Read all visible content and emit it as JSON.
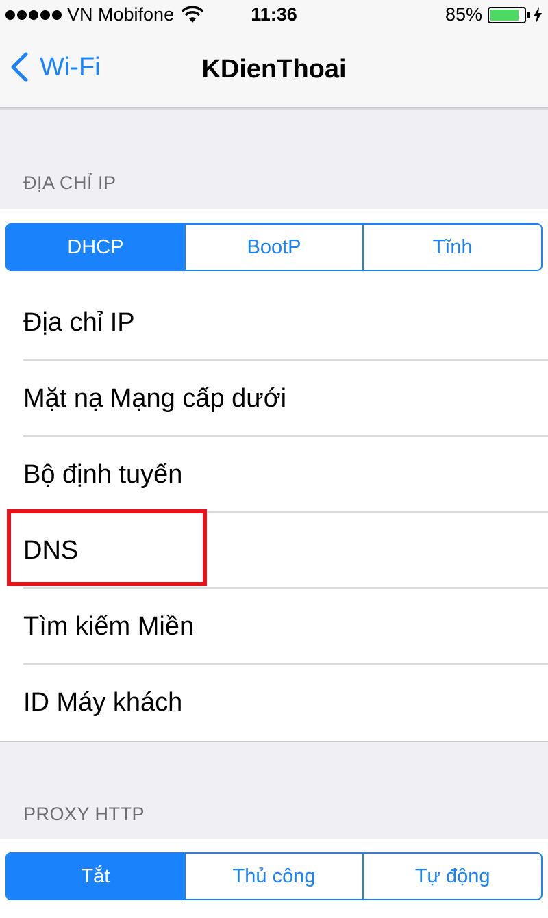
{
  "status_bar": {
    "carrier": "VN Mobifone",
    "time": "11:36",
    "battery_percent": "85%",
    "battery_level": 0.85,
    "signal_dots": 5
  },
  "nav": {
    "back_label": "Wi-Fi",
    "title": "KDienThoai"
  },
  "ip_section": {
    "header": "ĐỊA CHỈ IP",
    "segments": [
      "DHCP",
      "BootP",
      "Tĩnh"
    ],
    "selected": "DHCP",
    "rows": [
      "Địa chỉ IP",
      "Mặt nạ Mạng cấp dưới",
      "Bộ định tuyến",
      "DNS",
      "Tìm kiếm Miền",
      "ID Máy khách"
    ]
  },
  "proxy_section": {
    "header": "PROXY HTTP",
    "segments": [
      "Tắt",
      "Thủ công",
      "Tự động"
    ],
    "selected": "Tắt"
  },
  "colors": {
    "accent": "#1a82fb",
    "highlight": "#e5131d",
    "battery": "#4cd964",
    "background": "#efeff4"
  }
}
